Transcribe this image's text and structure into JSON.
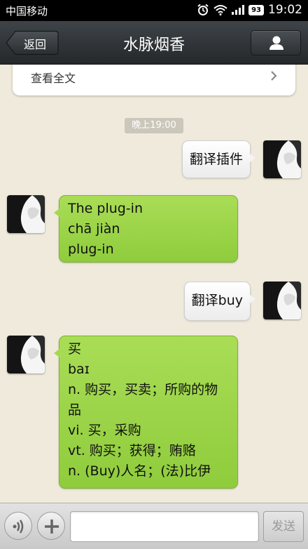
{
  "status_bar": {
    "carrier": "中国移动",
    "battery": "93",
    "time": "19:02"
  },
  "nav": {
    "back_label": "返回",
    "title": "水脉烟香"
  },
  "card": {
    "text": "查看全文"
  },
  "timestamp": "晚上19:00",
  "messages": [
    {
      "from": "me",
      "lines": [
        "翻译插件"
      ]
    },
    {
      "from": "them",
      "lines": [
        "The plug-in",
        "chā jiàn",
        "plug-in"
      ]
    },
    {
      "from": "me",
      "lines": [
        "翻译buy"
      ]
    },
    {
      "from": "them",
      "lines": [
        "买",
        "baɪ",
        "n. 购买，买卖；所购的物",
        "品",
        "vi. 买，采购",
        "vt. 购买；获得；贿赂",
        "n. (Buy)人名；(法)比伊"
      ]
    }
  ],
  "input": {
    "value": "",
    "placeholder": "",
    "send_label": "发送"
  },
  "colors": {
    "bubble_green": "#9dd349",
    "background": "#efeadb",
    "navbar": "#2e3236"
  }
}
